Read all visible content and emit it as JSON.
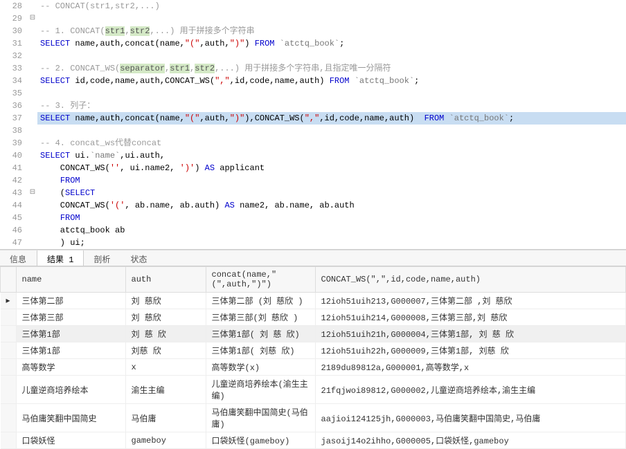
{
  "editor": {
    "lines": [
      {
        "num": 28,
        "fold": "",
        "tokens": [
          [
            "comment",
            "-- CONCAT(str1,str2,...)"
          ]
        ]
      },
      {
        "num": 29,
        "fold": "⊟",
        "tokens": []
      },
      {
        "num": 30,
        "fold": "",
        "tokens": [
          [
            "comment",
            "-- 1. CONCAT("
          ],
          [
            "param",
            "str1"
          ],
          [
            "comment",
            ","
          ],
          [
            "param",
            "str2"
          ],
          [
            "comment",
            ",...) 用于拼接多个字符串"
          ]
        ]
      },
      {
        "num": 31,
        "fold": "",
        "tokens": [
          [
            "keyword",
            "SELECT"
          ],
          [
            "ident",
            " name,auth,concat(name,"
          ],
          [
            "string",
            "\"(\""
          ],
          [
            "ident",
            ",auth,"
          ],
          [
            "string",
            "\")\""
          ],
          [
            "ident",
            ") "
          ],
          [
            "keyword",
            "FROM"
          ],
          [
            "ident",
            " "
          ],
          [
            "backtick",
            "`atctq_book`"
          ],
          [
            "ident",
            ";"
          ]
        ]
      },
      {
        "num": 32,
        "fold": "",
        "tokens": []
      },
      {
        "num": 33,
        "fold": "",
        "tokens": [
          [
            "comment",
            "-- 2. CONCAT_WS("
          ],
          [
            "param",
            "separator"
          ],
          [
            "comment",
            ","
          ],
          [
            "param",
            "str1"
          ],
          [
            "comment",
            ","
          ],
          [
            "param",
            "str2"
          ],
          [
            "comment",
            ",...) 用于拼接多个字符串,且指定唯一分隔符"
          ]
        ]
      },
      {
        "num": 34,
        "fold": "",
        "tokens": [
          [
            "keyword",
            "SELECT"
          ],
          [
            "ident",
            " id,code,name,auth,CONCAT_WS("
          ],
          [
            "string",
            "\",\""
          ],
          [
            "ident",
            ",id,code,name,auth) "
          ],
          [
            "keyword",
            "FROM"
          ],
          [
            "ident",
            " "
          ],
          [
            "backtick",
            "`atctq_book`"
          ],
          [
            "ident",
            ";"
          ]
        ]
      },
      {
        "num": 35,
        "fold": "",
        "tokens": []
      },
      {
        "num": 36,
        "fold": "",
        "tokens": [
          [
            "comment",
            "-- 3. 列子："
          ]
        ]
      },
      {
        "num": 37,
        "fold": "",
        "highlight": true,
        "tokens": [
          [
            "keyword",
            "SELECT"
          ],
          [
            "ident",
            " name,auth,concat(name,"
          ],
          [
            "string",
            "\"(\""
          ],
          [
            "ident",
            ",auth,"
          ],
          [
            "string",
            "\")\""
          ],
          [
            "ident",
            "),CONCAT_WS("
          ],
          [
            "string",
            "\",\""
          ],
          [
            "ident",
            ",id,code,name,auth)  "
          ],
          [
            "keyword",
            "FROM"
          ],
          [
            "ident",
            " "
          ],
          [
            "backtick",
            "`atctq_book`"
          ],
          [
            "ident",
            ";"
          ]
        ]
      },
      {
        "num": 38,
        "fold": "",
        "tokens": []
      },
      {
        "num": 39,
        "fold": "",
        "tokens": [
          [
            "comment",
            "-- 4. concat_ws代替concat"
          ]
        ]
      },
      {
        "num": 40,
        "fold": "",
        "tokens": [
          [
            "keyword",
            "SELECT"
          ],
          [
            "ident",
            " ui."
          ],
          [
            "backtick",
            "`name`"
          ],
          [
            "ident",
            ",ui.auth,"
          ]
        ]
      },
      {
        "num": 41,
        "fold": "",
        "tokens": [
          [
            "ident",
            "    CONCAT_WS("
          ],
          [
            "string",
            "''"
          ],
          [
            "ident",
            ", ui.name2, "
          ],
          [
            "string",
            "')'"
          ],
          [
            "ident",
            ") "
          ],
          [
            "keyword",
            "AS"
          ],
          [
            "ident",
            " applicant"
          ]
        ]
      },
      {
        "num": 42,
        "fold": "",
        "tokens": [
          [
            "ident",
            "    "
          ],
          [
            "keyword",
            "FROM"
          ]
        ]
      },
      {
        "num": 43,
        "fold": "⊟",
        "tokens": [
          [
            "ident",
            "    ("
          ],
          [
            "keyword",
            "SELECT"
          ]
        ]
      },
      {
        "num": 44,
        "fold": "",
        "tokens": [
          [
            "ident",
            "    CONCAT_WS("
          ],
          [
            "string",
            "'('"
          ],
          [
            "ident",
            ", ab.name, ab.auth) "
          ],
          [
            "keyword",
            "AS"
          ],
          [
            "ident",
            " name2, ab.name, ab.auth"
          ]
        ]
      },
      {
        "num": 45,
        "fold": "",
        "tokens": [
          [
            "ident",
            "    "
          ],
          [
            "keyword",
            "FROM"
          ]
        ]
      },
      {
        "num": 46,
        "fold": "",
        "tokens": [
          [
            "ident",
            "    atctq_book ab"
          ]
        ]
      },
      {
        "num": 47,
        "fold": "",
        "tokens": [
          [
            "ident",
            "    ) ui;"
          ]
        ]
      }
    ]
  },
  "tabs": {
    "items": [
      "信息",
      "结果 1",
      "剖析",
      "状态"
    ],
    "activeIndex": 1
  },
  "results": {
    "columns": [
      "name",
      "auth",
      "concat(name,\"(\",auth,\")\")",
      "CONCAT_WS(\",\",id,code,name,auth)"
    ],
    "rows": [
      [
        "三体第二部",
        "刘 慈欣",
        "三体第二部 (刘 慈欣  )",
        "12ioh51uih213,G000007,三体第二部 ,刘 慈欣"
      ],
      [
        "三体第三部",
        "刘 慈欣",
        "三体第三部(刘 慈欣 )",
        "12ioh51uih214,G000008,三体第三部,刘 慈欣"
      ],
      [
        "三体第1部",
        " 刘 慈 欣",
        "三体第1部(  刘 慈 欣)",
        "12ioh51uih21h,G000004,三体第1部,  刘 慈 欣"
      ],
      [
        "三体第1部",
        "刘慈 欣",
        "三体第1部( 刘慈 欣)",
        "12ioh51uih22h,G000009,三体第1部, 刘慈 欣"
      ],
      [
        "高等数学",
        "x",
        "高等数学(x)",
        "2189du89812a,G000001,高等数学,x"
      ],
      [
        "儿童逆商培养绘本",
        "渝生主编",
        "儿童逆商培养绘本(渝生主编)",
        "21fqjwoi89812,G000002,儿童逆商培养绘本,渝生主编"
      ],
      [
        "马伯庸笑翻中国简史",
        "马伯庸",
        "马伯庸笑翻中国简史(马伯庸)",
        "aajioi124125jh,G000003,马伯庸笑翻中国简史,马伯庸"
      ],
      [
        "口袋妖怪",
        "gameboy",
        "口袋妖怪(gameboy)",
        "jasoij14o2ihho,G000005,口袋妖怪,gameboy"
      ]
    ],
    "activeRowIndex": 0
  }
}
